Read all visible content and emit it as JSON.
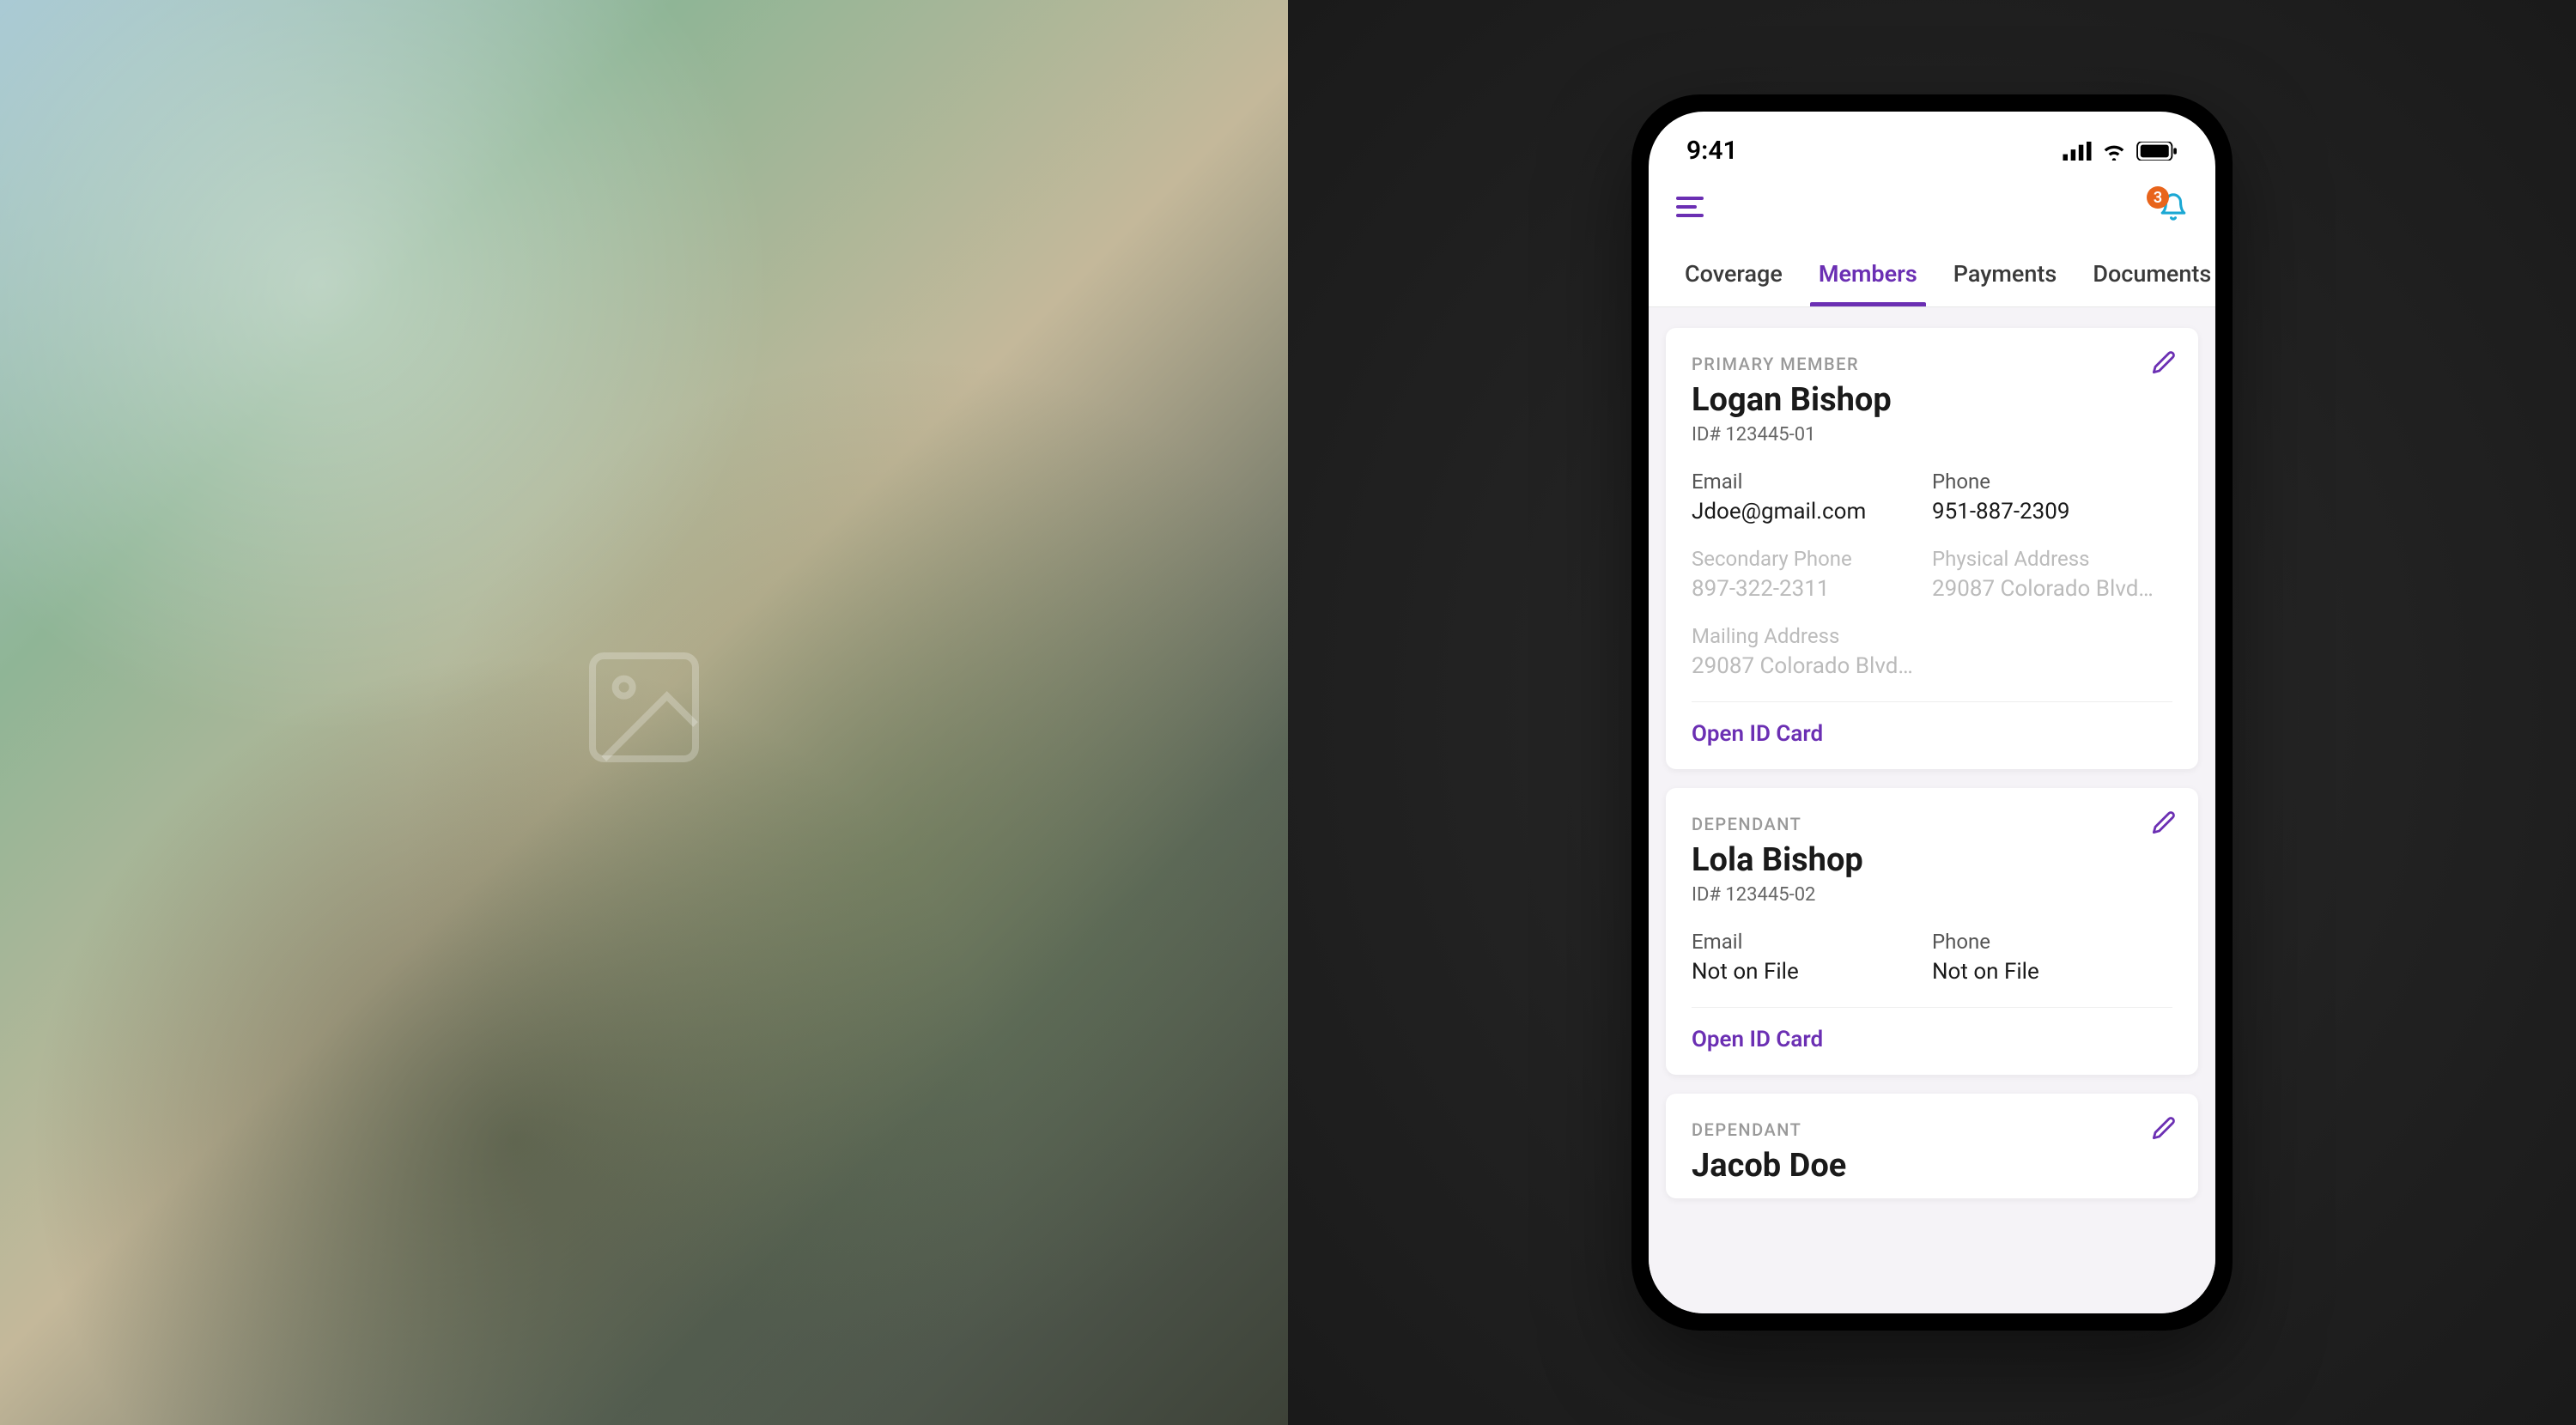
{
  "statusBar": {
    "time": "9:41"
  },
  "header": {
    "notifCount": "3"
  },
  "tabs": [
    {
      "label": "Coverage",
      "active": false
    },
    {
      "label": "Members",
      "active": true
    },
    {
      "label": "Payments",
      "active": false
    },
    {
      "label": "Documents",
      "active": false
    }
  ],
  "members": [
    {
      "role": "PRIMARY MEMBER",
      "name": "Logan Bishop",
      "id": "ID# 123445-01",
      "fields": {
        "emailLabel": "Email",
        "emailValue": "Jdoe@gmail.com",
        "phoneLabel": "Phone",
        "phoneValue": "951-887-2309",
        "secPhoneLabel": "Secondary Phone",
        "secPhoneValue": "897-322-2311",
        "physAddrLabel": "Physical Address",
        "physAddrValue": "29087 Colorado Blvd…",
        "mailAddrLabel": "Mailing Address",
        "mailAddrValue": "29087 Colorado Blvd…"
      },
      "action": "Open ID Card"
    },
    {
      "role": "DEPENDANT",
      "name": "Lola Bishop",
      "id": "ID# 123445-02",
      "fields": {
        "emailLabel": "Email",
        "emailValue": "Not on File",
        "phoneLabel": "Phone",
        "phoneValue": "Not on File"
      },
      "action": "Open ID Card"
    },
    {
      "role": "DEPENDANT",
      "name": "Jacob Doe"
    }
  ]
}
